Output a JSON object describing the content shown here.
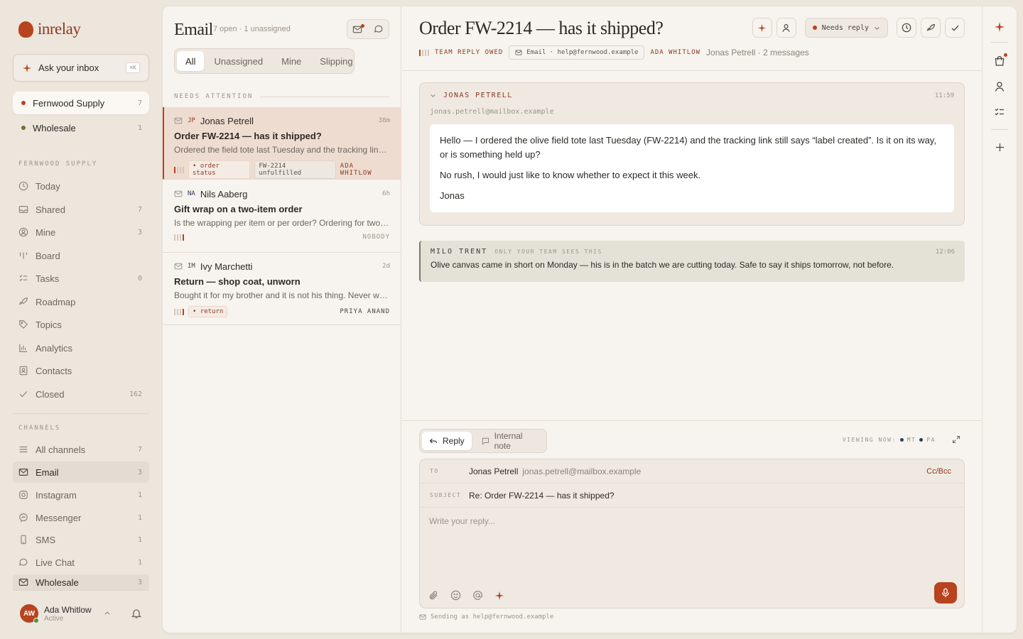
{
  "app": {
    "name": "inrelay"
  },
  "sidebar": {
    "ask": {
      "label": "Ask your inbox",
      "shortcut": "⌘K"
    },
    "workspaces": [
      {
        "label": "Fernwood Supply",
        "count": "7",
        "dot_color": "#b8431f"
      },
      {
        "label": "Wholesale",
        "count": "1",
        "dot_color": "#7b6a2e"
      }
    ],
    "section_fernwood": "FERNWOOD SUPPLY",
    "nav": [
      {
        "label": "Today",
        "count": "",
        "icon": "clock-icon"
      },
      {
        "label": "Shared",
        "count": "7",
        "icon": "inbox-icon"
      },
      {
        "label": "Mine",
        "count": "3",
        "icon": "user-circle-icon"
      },
      {
        "label": "Board",
        "count": "",
        "icon": "board-icon"
      },
      {
        "label": "Tasks",
        "count": "0",
        "icon": "tasks-icon"
      },
      {
        "label": "Roadmap",
        "count": "",
        "icon": "rocket-icon"
      },
      {
        "label": "Topics",
        "count": "",
        "icon": "tag-icon"
      },
      {
        "label": "Analytics",
        "count": "",
        "icon": "chart-icon"
      },
      {
        "label": "Contacts",
        "count": "",
        "icon": "contact-icon"
      },
      {
        "label": "Closed",
        "count": "162",
        "icon": "check-icon"
      }
    ],
    "section_channels": "CHANNELS",
    "channels": [
      {
        "label": "All channels",
        "count": "7",
        "icon": "list-icon"
      },
      {
        "label": "Email",
        "count": "3",
        "icon": "mail-icon"
      },
      {
        "label": "Instagram",
        "count": "1",
        "icon": "instagram-icon"
      },
      {
        "label": "Messenger",
        "count": "1",
        "icon": "messenger-icon"
      },
      {
        "label": "SMS",
        "count": "1",
        "icon": "phone-icon"
      },
      {
        "label": "Live Chat",
        "count": "1",
        "icon": "chat-icon"
      },
      {
        "label": "Wholesale",
        "count": "3",
        "icon": "mail-icon"
      }
    ],
    "user": {
      "initials": "AW",
      "name": "Ada Whitlow",
      "status": "Active"
    }
  },
  "list": {
    "title": "Email",
    "subtitle": "7 open · 1 unassigned",
    "tabs": [
      "All",
      "Unassigned",
      "Mine",
      "Slipping"
    ],
    "section": "NEEDS ATTENTION",
    "conversations": [
      {
        "initials": "JP",
        "name": "Jonas Petrell",
        "time": "38m",
        "subject": "Order FW-2214 — has it shipped?",
        "preview": "Ordered the field tote last Tuesday and the tracking link still says label created.",
        "tags": [
          "• order status",
          "FW-2214 unfulfilled"
        ],
        "assignee": "ADA WHITLOW"
      },
      {
        "initials": "NA",
        "name": "Nils Aaberg",
        "time": "6h",
        "subject": "Gift wrap on a two-item order",
        "preview": "Is the wrapping per item or per order? Ordering for two people.",
        "tags": [],
        "assignee": "NOBODY"
      },
      {
        "initials": "IM",
        "name": "Ivy Marchetti",
        "time": "2d",
        "subject": "Return — shop coat, unworn",
        "preview": "Bought it for my brother and it is not his thing. Never worn, tags still on.",
        "tags": [
          "• return"
        ],
        "assignee": "PRIYA ANAND"
      }
    ]
  },
  "detail": {
    "title": "Order FW-2214 — has it shipped?",
    "status": "Needs reply",
    "status_color": "#b8431f",
    "owed": "TEAM REPLY OWED",
    "channel": "Email · help@fernwood.example",
    "owner": "ADA WHITLOW",
    "contact_meta": "Jonas Petrell · 2 messages",
    "message": {
      "sender": "JONAS PETRELL",
      "time": "11:59",
      "email": "jonas.petrell@mailbox.example",
      "paragraphs": [
        "Hello — I ordered the olive field tote last Tuesday (FW-2214) and the tracking link still says “label created”. Is it on its way, or is something held up?",
        "No rush, I would just like to know whether to expect it this week.",
        "Jonas"
      ]
    },
    "note": {
      "author": "MILO TRENT",
      "visibility": "ONLY YOUR TEAM SEES THIS",
      "time": "12:06",
      "body": "Olive canvas came in short on Monday — his is in the batch we are cutting today. Safe to say it ships tomorrow, not before."
    },
    "composer": {
      "tabs": [
        "Reply",
        "Internal note"
      ],
      "viewing_label": "VIEWING NOW:",
      "viewers": [
        "MT",
        "PA"
      ],
      "to_label": "TO",
      "to_name": "Jonas Petrell",
      "to_email": "jonas.petrell@mailbox.example",
      "ccbcc": "Cc/Bcc",
      "subject_label": "SUBJECT",
      "subject": "Re: Order FW-2214 — has it shipped?",
      "placeholder": "Write your reply...",
      "sending_as": "Sending as help@fernwood.example"
    }
  },
  "colors": {
    "accent": "#b8431f",
    "bg": "#ece6dd",
    "panel": "#f7f3ee"
  }
}
